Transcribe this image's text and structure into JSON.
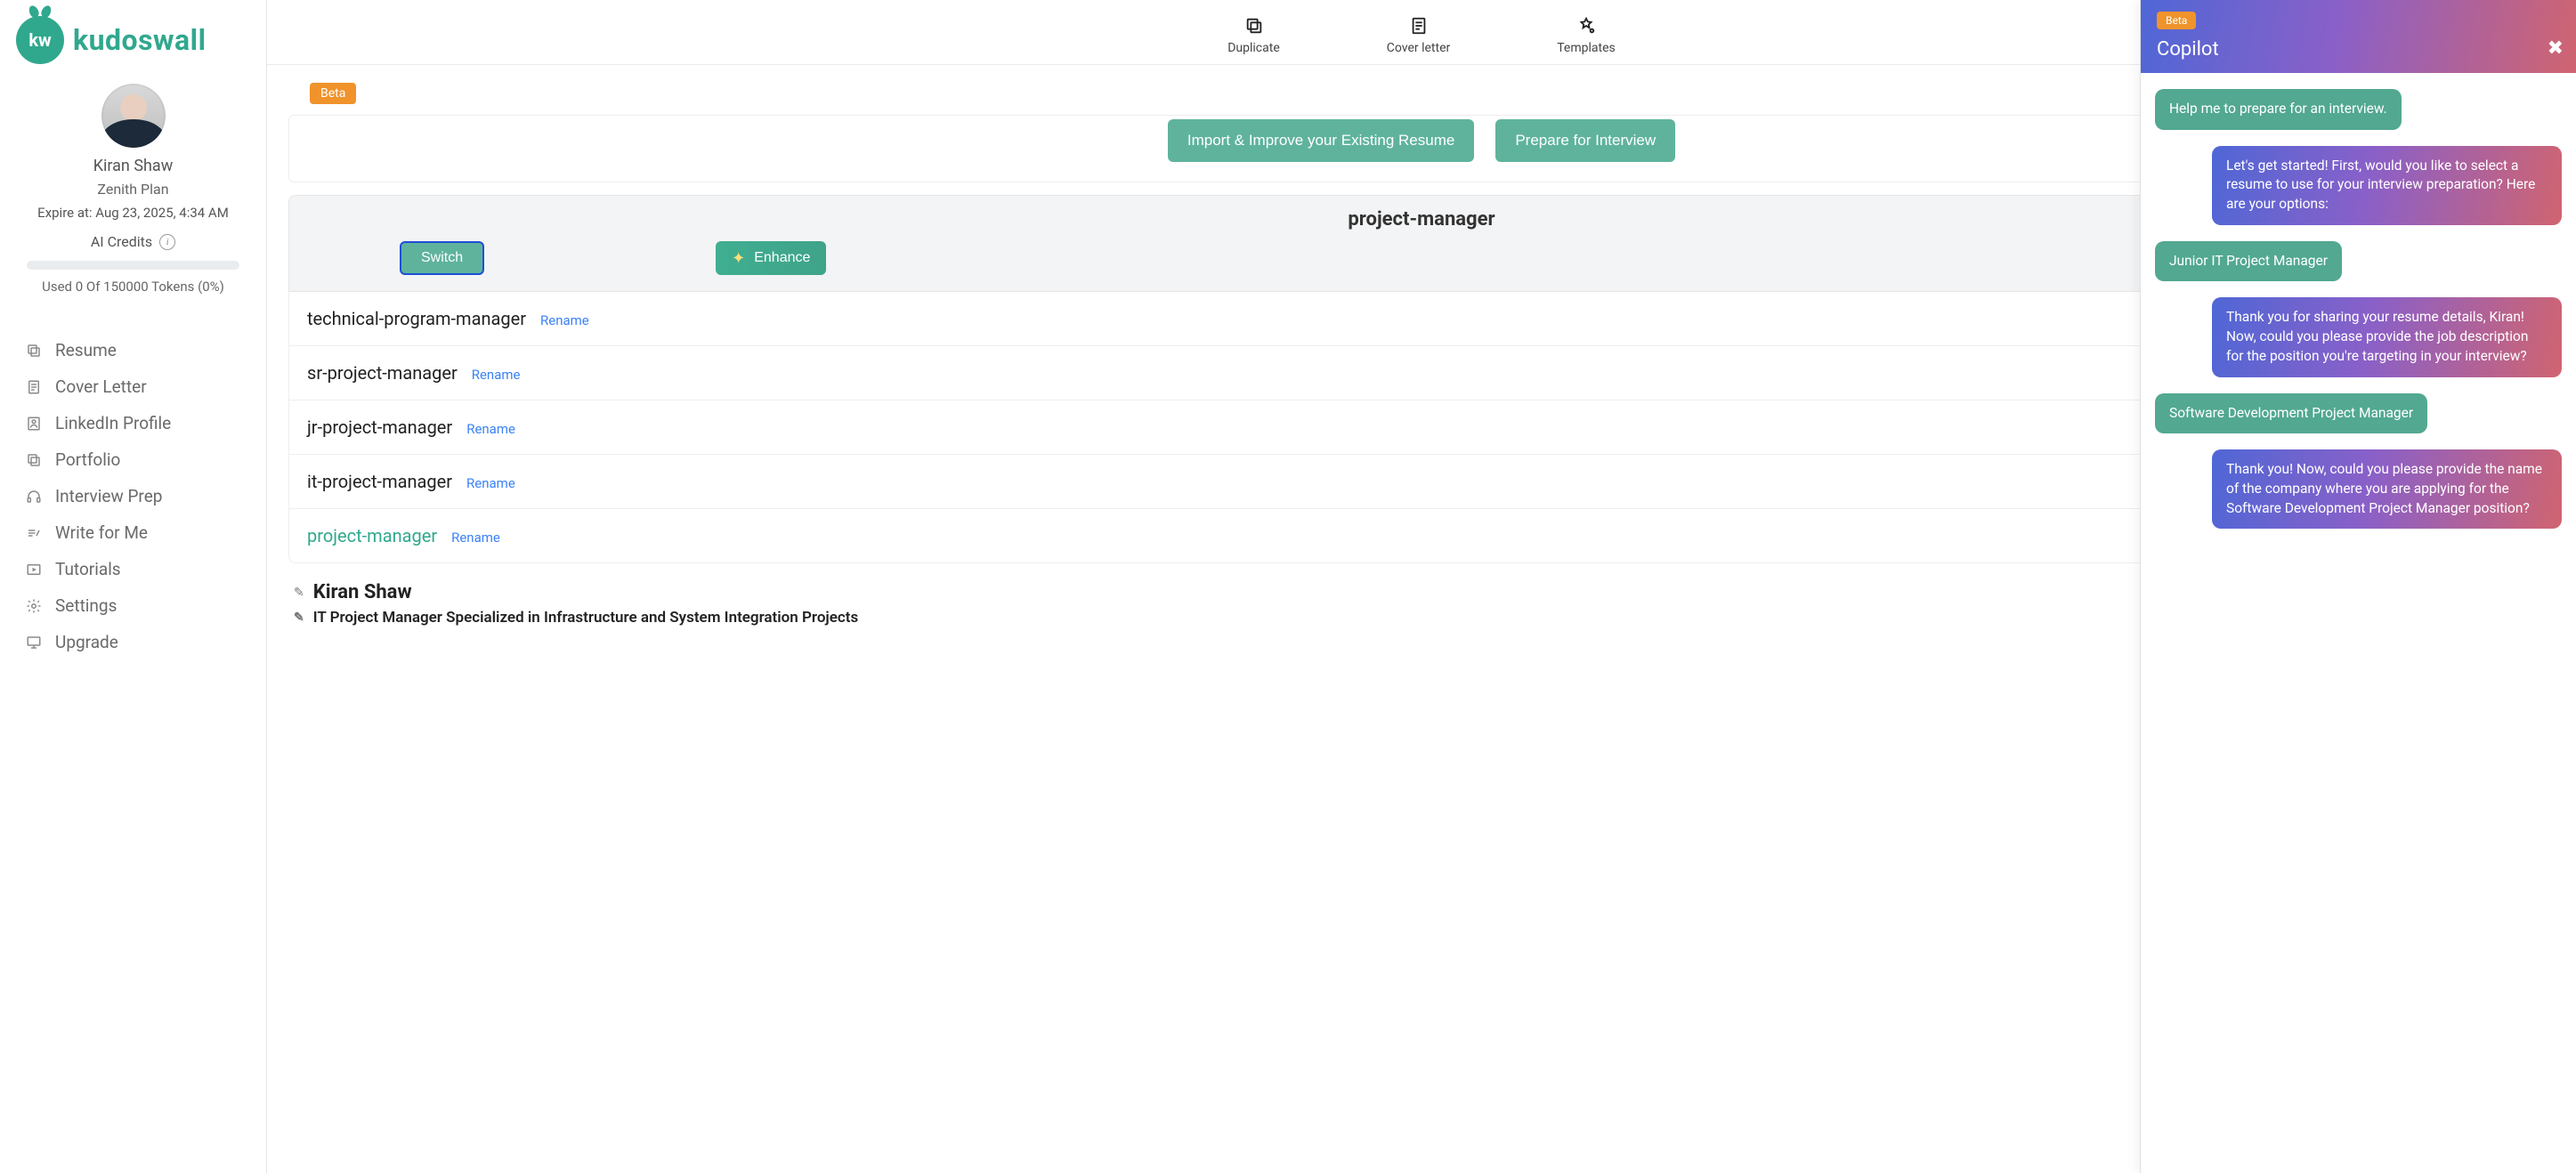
{
  "brand": {
    "name": "kudoswall",
    "badge": "kw"
  },
  "user": {
    "name": "Kiran Shaw",
    "plan": "Zenith Plan",
    "expire": "Expire at: Aug 23, 2025, 4:34 AM",
    "credits_label": "AI Credits",
    "tokens_line": "Used 0 Of 150000 Tokens (0%)"
  },
  "nav": {
    "resume": "Resume",
    "cover": "Cover Letter",
    "linkedin": "LinkedIn Profile",
    "portfolio": "Portfolio",
    "interview": "Interview Prep",
    "write": "Write for Me",
    "tutorials": "Tutorials",
    "settings": "Settings",
    "upgrade": "Upgrade"
  },
  "toolbar": {
    "duplicate": "Duplicate",
    "cover": "Cover letter",
    "templates": "Templates"
  },
  "beta_label": "Beta",
  "actions": {
    "import": "Import & Improve your Existing Resume",
    "prepare": "Prepare for Interview",
    "switch": "Switch",
    "enhance": "Enhance"
  },
  "resume": {
    "title": "project-manager",
    "rename": "Rename",
    "items": [
      {
        "name": "technical-program-manager",
        "active": false
      },
      {
        "name": "sr-project-manager",
        "active": false
      },
      {
        "name": "jr-project-manager",
        "active": false
      },
      {
        "name": "it-project-manager",
        "active": false
      },
      {
        "name": "project-manager",
        "active": true
      }
    ]
  },
  "profile": {
    "name": "Kiran Shaw",
    "subtitle": "IT Project Manager Specialized in Infrastructure and System Integration Projects"
  },
  "copilot": {
    "beta": "Beta",
    "title": "Copilot",
    "messages": [
      {
        "role": "user",
        "text": "Help me to prepare for an interview."
      },
      {
        "role": "bot",
        "text": "Let's get started! First, would you like to select a resume to use for your interview preparation? Here are your options:"
      },
      {
        "role": "user",
        "text": "Junior IT Project Manager"
      },
      {
        "role": "bot",
        "text": "Thank you for sharing your resume details, Kiran! Now, could you please provide the job description for the position you're targeting in your interview?"
      },
      {
        "role": "user",
        "text": "Software Development Project Manager"
      },
      {
        "role": "bot",
        "text": "Thank you! Now, could you please provide the name of the company where you are applying for the Software Development Project Manager position?"
      }
    ]
  }
}
